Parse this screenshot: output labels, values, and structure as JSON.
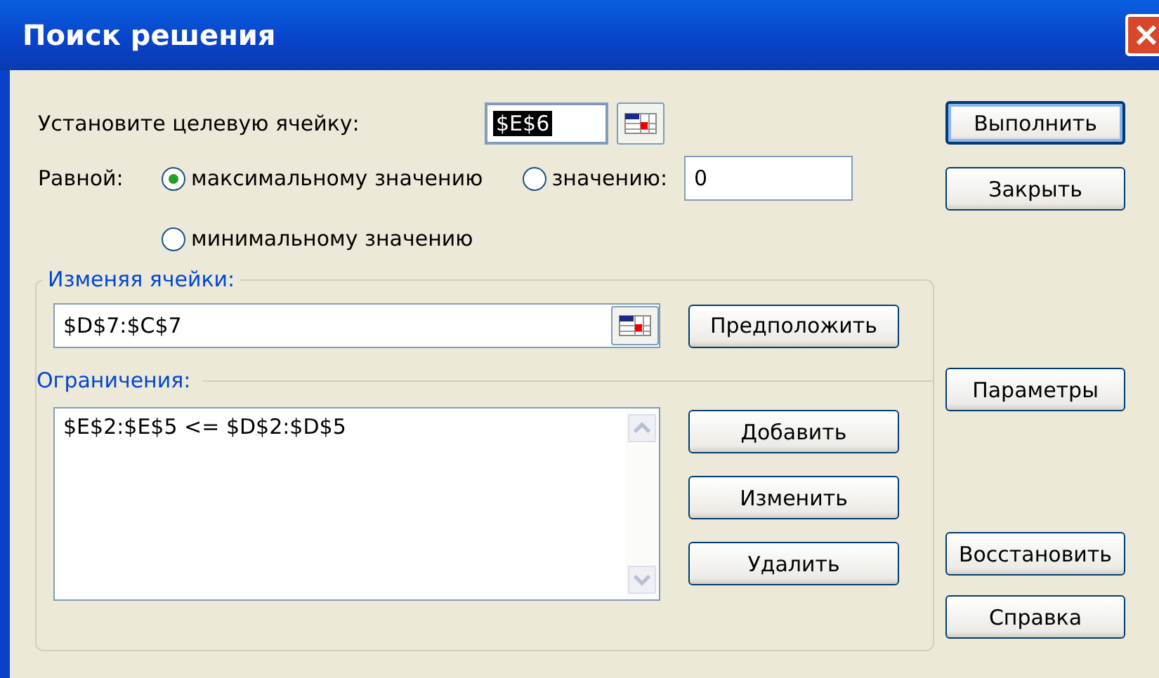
{
  "window": {
    "title": "Поиск решения"
  },
  "target": {
    "label": "Установите целевую ячейку:",
    "value": "$E$6",
    "highlighted": true
  },
  "equal_to": {
    "label": "Равной:",
    "value": "0",
    "options": [
      {
        "label": "максимальному значению",
        "selected": true
      },
      {
        "label": "значению:",
        "selected": false
      },
      {
        "label": "минимальному значению",
        "selected": false
      }
    ]
  },
  "changing_cells": {
    "label": "Изменяя ячейки:",
    "value": "$D$7:$C$7",
    "button": "Предположить"
  },
  "constraints": {
    "label": "Ограничения:",
    "items": [
      "$E$2:$E$5 <= $D$2:$D$5"
    ],
    "buttons": [
      "Добавить",
      "Изменить",
      "Удалить"
    ]
  },
  "side_buttons": [
    {
      "label": "Выполнить",
      "default": true
    },
    {
      "label": "Закрыть",
      "default": false
    },
    {
      "label": "Параметры",
      "default": false
    },
    {
      "label": "Восстановить",
      "default": false
    },
    {
      "label": "Справка",
      "default": false
    }
  ]
}
